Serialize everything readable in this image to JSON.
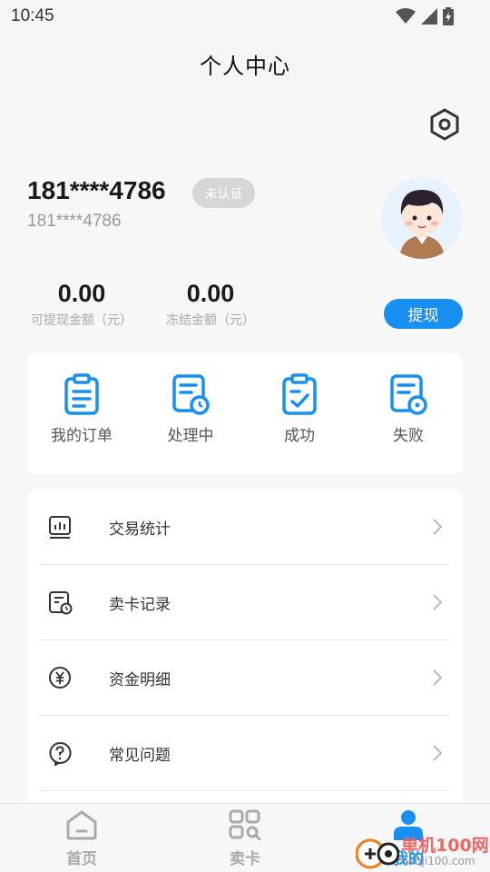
{
  "status_bar": {
    "time": "10:45"
  },
  "header": {
    "title": "个人中心"
  },
  "profile": {
    "name": "181****4786",
    "verify_badge": "未认证",
    "account": "181****4786"
  },
  "balances": [
    {
      "amount": "0.00",
      "label": "可提现金额（元）"
    },
    {
      "amount": "0.00",
      "label": "冻结金额（元）"
    }
  ],
  "withdraw_label": "提现",
  "orders": [
    {
      "label": "我的订单",
      "icon": "order-list-icon"
    },
    {
      "label": "处理中",
      "icon": "processing-icon"
    },
    {
      "label": "成功",
      "icon": "success-clipboard-icon"
    },
    {
      "label": "失败",
      "icon": "failed-icon"
    }
  ],
  "menu": [
    {
      "label": "交易统计",
      "icon": "stats-icon"
    },
    {
      "label": "卖卡记录",
      "icon": "card-record-icon"
    },
    {
      "label": "资金明细",
      "icon": "yuan-icon"
    },
    {
      "label": "常见问题",
      "icon": "question-icon"
    }
  ],
  "tabs": [
    {
      "label": "首页",
      "icon": "home-icon"
    },
    {
      "label": "卖卡",
      "icon": "grid-search-icon"
    },
    {
      "label": "我的",
      "icon": "user-icon"
    }
  ],
  "watermark": {
    "text": "单机100网",
    "url": "danji100.com"
  },
  "colors": {
    "accent": "#1890f1",
    "badge": "#d6d6d6"
  }
}
